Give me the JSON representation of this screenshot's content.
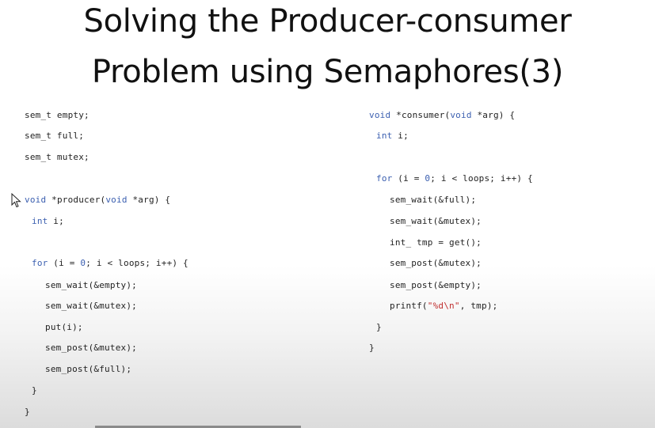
{
  "slide": {
    "title_line1": "Solving the Producer-consumer",
    "title_line2": "Problem using Semaphores(3)"
  },
  "left_code": [
    "sem_t empty;",
    "sem_t full;",
    "sem_t mutex;",
    "void *producer(void *arg) {",
    "int i;",
    "for (i = 0; i < loops; i++) {",
    "sem_wait(&empty);",
    "sem_wait(&mutex);",
    "put(i);",
    "sem_post(&mutex);",
    "sem_post(&full);",
    "}",
    "}"
  ],
  "right_code": [
    "void *consumer(void *arg) {",
    "int i;",
    "for (i = 0; i < loops; i++) {",
    "sem_wait(&full);",
    "sem_wait(&mutex);",
    "int_ tmp = get();",
    "sem_post(&mutex);",
    "sem_post(&empty);",
    "printf(\"%d\\n\", tmp);",
    "}",
    "}"
  ],
  "icons": {
    "cursor": "mouse-pointer-icon"
  }
}
